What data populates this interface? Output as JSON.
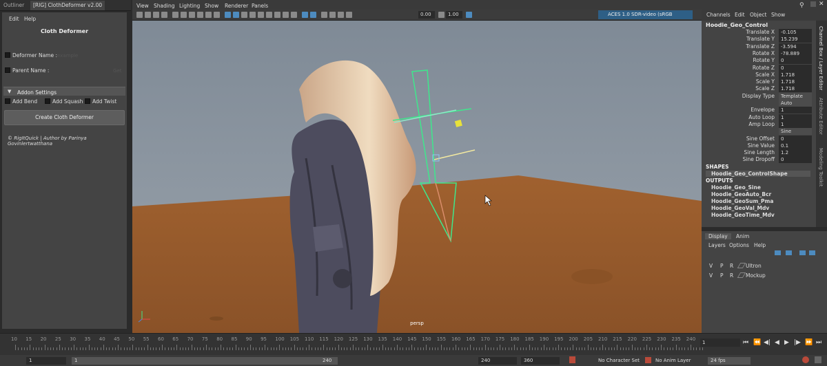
{
  "tabs": {
    "outliner": "Outliner",
    "window": "[RIG] ClothDeformer v2.00"
  },
  "left": {
    "menu": [
      "Edit",
      "Help"
    ],
    "title": "Cloth Deformer",
    "deformer_label": "Deformer Name :",
    "deformer_placeholder": "example",
    "parent_label": "Parent Name :",
    "get_label": "Get",
    "addon_label": "Addon Settings",
    "opts": [
      "Add Bend",
      "Add Squash",
      "Add Twist"
    ],
    "create_label": "Create Cloth Deformer",
    "credit": "© RigItQuick | Author by Parinya Govinlertwatthana"
  },
  "viewport": {
    "menu": [
      "View",
      "Shading",
      "Lighting",
      "Show",
      "Renderer",
      "Panels"
    ],
    "exposure": "0.00",
    "gamma": "1.00",
    "colorspace": "ACES 1.0 SDR-video (sRGB",
    "camera": "persp"
  },
  "channelbox": {
    "menu": [
      "Channels",
      "Edit",
      "Object",
      "Show"
    ],
    "object": "Hoodie_Geo_Control",
    "attrs": [
      [
        "Translate X",
        "-0.105"
      ],
      [
        "Translate Y",
        "15.239"
      ],
      [
        "Translate Z",
        "-3.594"
      ],
      [
        "Rotate X",
        "-78.889"
      ],
      [
        "Rotate Y",
        "0"
      ],
      [
        "Rotate Z",
        "0"
      ],
      [
        "Scale X",
        "1.718"
      ],
      [
        "Scale Y",
        "1.718"
      ],
      [
        "Scale Z",
        "1.718"
      ],
      [
        "Display Type",
        "Template"
      ],
      [
        "",
        "Auto"
      ],
      [
        "Envelope",
        "1"
      ],
      [
        "Auto Loop",
        "1"
      ],
      [
        "Amp Loop",
        "1"
      ],
      [
        "",
        "Sine"
      ],
      [
        "Sine Offset",
        "0"
      ],
      [
        "Sine Value",
        "0.1"
      ],
      [
        "Sine Length",
        "1.2"
      ],
      [
        "Sine Dropoff",
        "0"
      ]
    ],
    "shapes_label": "SHAPES",
    "shapes": [
      "Hoodie_Geo_ControlShape"
    ],
    "outputs_label": "OUTPUTS",
    "outputs": [
      "Hoodie_Geo_Sine",
      "Hoodie_GeoAuto_Bcr",
      "Hoodie_GeoSum_Pma",
      "Hoodie_GeoVal_Mdv",
      "Hoodie_GeoTime_Mdv"
    ]
  },
  "side_tabs": [
    "Channel Box / Layer Editor",
    "Attribute Editor",
    "Modeling Toolkit"
  ],
  "layers": {
    "tabs": [
      "Display",
      "Anim"
    ],
    "menu": [
      "Layers",
      "Options",
      "Help"
    ],
    "rows": [
      {
        "v": "V",
        "p": "P",
        "r": "R",
        "name": "Ultron"
      },
      {
        "v": "V",
        "p": "P",
        "r": "R",
        "name": "Mockup"
      }
    ]
  },
  "timeline": {
    "ticks": [
      "10",
      "15",
      "20",
      "25",
      "30",
      "35",
      "40",
      "45",
      "50",
      "55",
      "60",
      "65",
      "70",
      "75",
      "80",
      "85",
      "90",
      "95",
      "100",
      "105",
      "110",
      "115",
      "120",
      "125",
      "130",
      "135",
      "140",
      "145",
      "150",
      "155",
      "160",
      "165",
      "170",
      "175",
      "180",
      "185",
      "190",
      "195",
      "200",
      "205",
      "210",
      "215",
      "220",
      "225",
      "230",
      "235",
      "240"
    ],
    "current_frame": "1"
  },
  "range": {
    "start": "1",
    "inner_start": "1",
    "inner_end": "240",
    "end": "240",
    "max": "360",
    "char_set": "No Character Set",
    "anim_layer": "No Anim Layer",
    "fps": "24 fps"
  },
  "colors": {
    "sky": "#8f99a3",
    "ground": "#9a5c2e",
    "accent": "#4d8bbf",
    "cloth": "#ead2b4",
    "rig": "#3ee88c"
  }
}
